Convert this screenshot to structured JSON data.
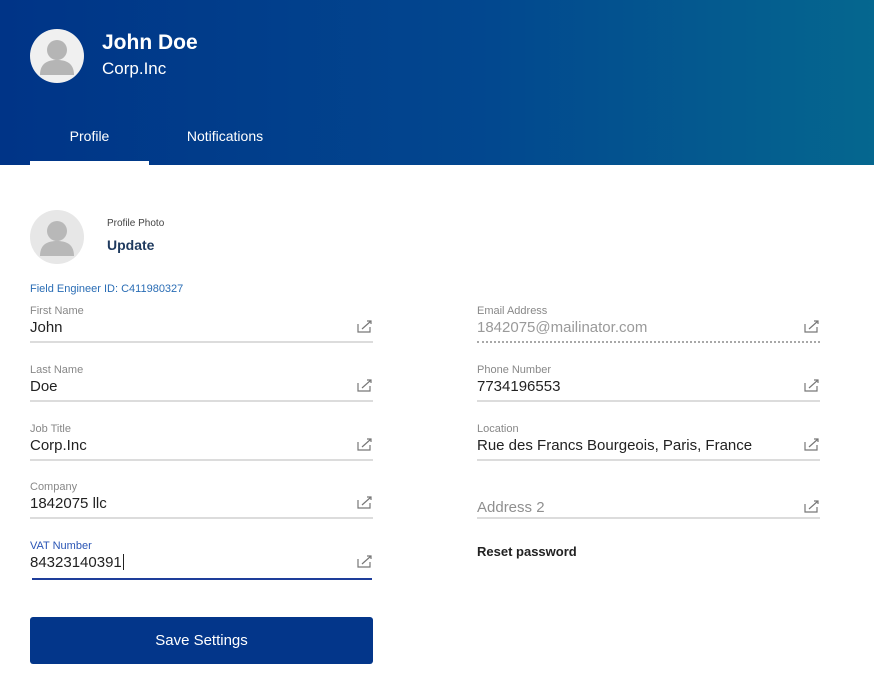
{
  "header": {
    "name": "John Doe",
    "company": "Corp.Inc",
    "avatar_icon": "user-silhouette-icon",
    "gradient": [
      "#003487",
      "#05678f"
    ]
  },
  "tabs": [
    {
      "label": "Profile",
      "active": true
    },
    {
      "label": "Notifications",
      "active": false
    }
  ],
  "profile_photo": {
    "label": "Profile Photo",
    "action": "Update"
  },
  "engineer_id": "Field Engineer ID: C411980327",
  "fields": {
    "first_name": {
      "label": "First Name",
      "value": "John"
    },
    "last_name": {
      "label": "Last Name",
      "value": "Doe"
    },
    "job_title": {
      "label": "Job Title",
      "value": "Corp.Inc"
    },
    "company": {
      "label": "Company",
      "value": "1842075 llc"
    },
    "vat_number": {
      "label": "VAT Number",
      "value": "84323140391"
    },
    "email": {
      "label": "Email Address",
      "value": "1842075@mailinator.com"
    },
    "phone": {
      "label": "Phone Number",
      "value": "7734196553"
    },
    "location": {
      "label": "Location",
      "value": "Rue des Francs Bourgeois, Paris, France"
    },
    "address2": {
      "placeholder": "Address 2"
    }
  },
  "reset_password": "Reset password",
  "save_button": "Save Settings",
  "colors": {
    "accent": "#03368a",
    "active_field": "#1e3d9a",
    "link": "#2a6db5"
  }
}
